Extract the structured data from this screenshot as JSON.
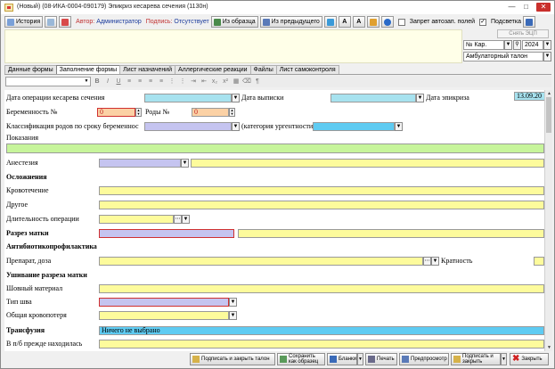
{
  "window": {
    "title": "(Новый) (08-ИКА-0004-090179) Эпикриз кесарева сечения (1130н)"
  },
  "toolbar": {
    "history": "История",
    "author_label": "Автор:",
    "author_value": "Администратор",
    "signature_label": "Подпись:",
    "signature_value": "Отсутствует",
    "from_template": "Из образца",
    "from_previous": "Из предыдущего",
    "autofill_block": "Запрет автозап. полей",
    "highlight": "Подсветка"
  },
  "side": {
    "ecp": "Снять ЭЦП",
    "num_label": "№ Кар.",
    "year": "2024",
    "card_type": "Амбулаторный талон"
  },
  "tabs": [
    "Данные формы",
    "Заполнение формы",
    "Лист назначений",
    "Аллергические реакции",
    "Файлы",
    "Лист самоконтроля"
  ],
  "form": {
    "op_date": "Дата операции кесарева сечения",
    "discharge_date": "Дата выписки",
    "epicrisis_date": "Дата эпикриза",
    "epicrisis_value": "13.09.20",
    "pregnancy_no": "Беременность №",
    "pregnancy_value": "0",
    "births_no": "Роды №",
    "births_value": "0",
    "classification": "Классификация родов по сроку беременнос",
    "urgency": "(категория ургентности:",
    "indications": "Показания",
    "anesthesia": "Анестезия",
    "complications": "Осложнения",
    "bleeding": "Кровотечение",
    "other": "Другое",
    "duration": "Длительность операции",
    "uterine_incision": "Разрез матки",
    "antibiotic": "Антибиотикопрофилактика",
    "drug_dose": "Препарат, доза",
    "frequency": "Кратность",
    "suturing": "Ушивание разреза матки",
    "suture_material": "Шовный материал",
    "suture_type": "Тип шва",
    "blood_loss": "Общая кровопотеря",
    "transfusion": "Трансфузия",
    "transfusion_value": "Ничего не выбрано",
    "postop_location": "В п/б прежде находилась"
  },
  "footer": {
    "sign_close_talon": "Подписать и закрыть талон",
    "save_as_template": "Сохранить как образец",
    "forms": "Бланки",
    "print": "Печать",
    "preview": "Предпросмотр",
    "sign_close": "Подписать и закрыть",
    "close": "Закрыть"
  },
  "colors": {
    "yellow": "#fdfb9c",
    "cyan": "#a7e2ef",
    "lavender": "#c5c4f0",
    "orange": "#fbd1a5",
    "green": "#c7f59b",
    "blue": "#5ecbf2"
  }
}
